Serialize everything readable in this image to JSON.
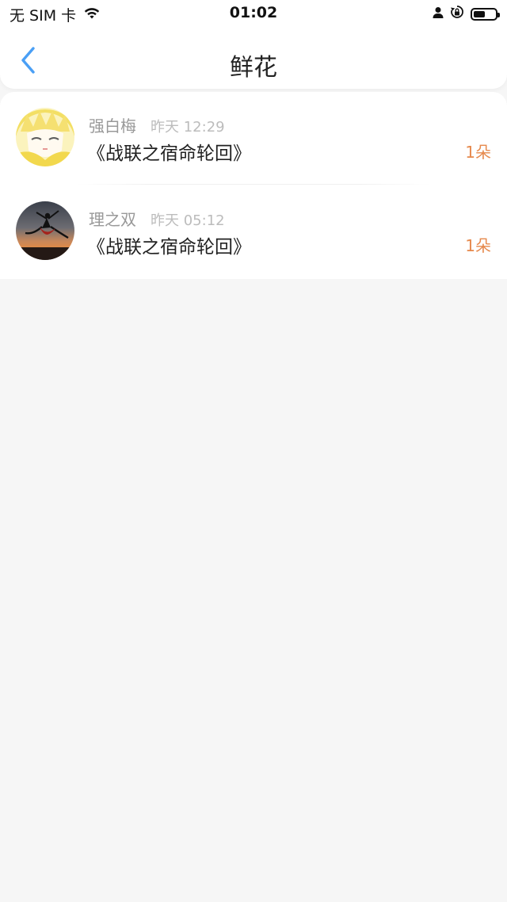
{
  "status_bar": {
    "carrier": "无 SIM 卡",
    "time": "01:02",
    "battery_level": 0.55,
    "icons": [
      "wifi-icon",
      "person-icon",
      "orientation-lock-icon",
      "battery-icon"
    ]
  },
  "nav": {
    "back_icon": "chevron-left-icon",
    "title": "鲜花"
  },
  "colors": {
    "accent": "#4a9ff5",
    "count": "#e6894c",
    "background": "#f6f6f6"
  },
  "items": [
    {
      "name": "强白梅",
      "time": "昨天 12:29",
      "book": "《战联之宿命轮回》",
      "count": "1朵",
      "avatar": "anime-avatar"
    },
    {
      "name": "理之双",
      "time": "昨天 05:12",
      "book": "《战联之宿命轮回》",
      "count": "1朵",
      "avatar": "sunset-dancer-avatar"
    }
  ]
}
